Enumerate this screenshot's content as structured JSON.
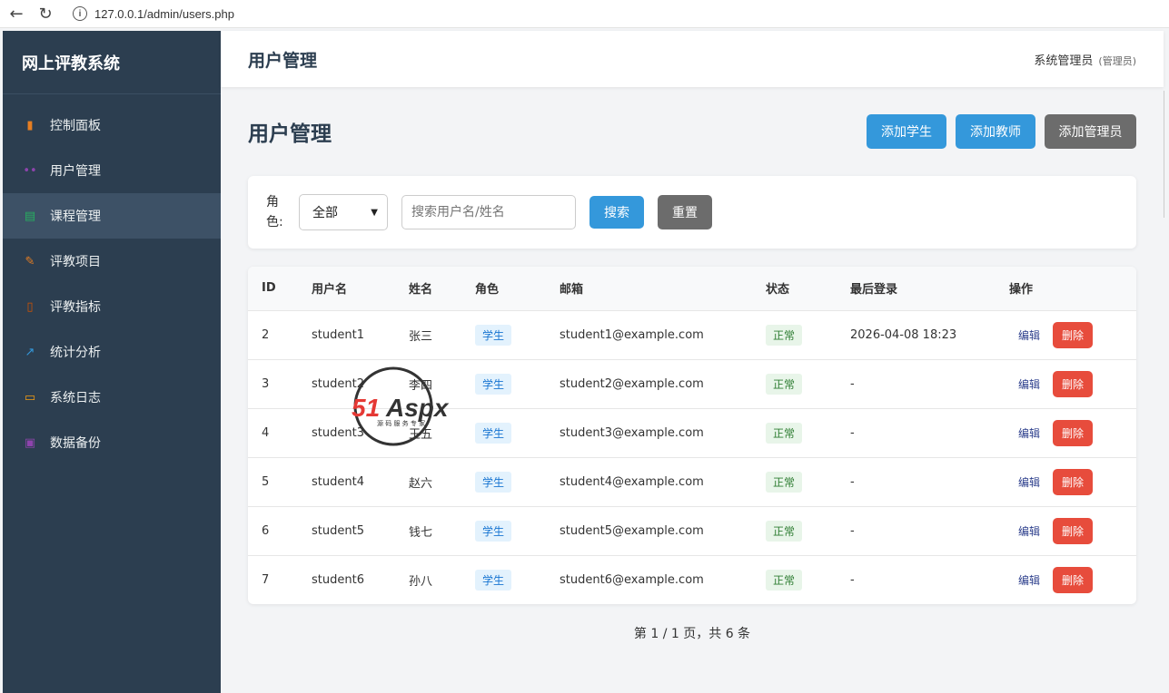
{
  "browser": {
    "url": "127.0.0.1/admin/users.php"
  },
  "sidebar": {
    "brand": "网上评教系统",
    "items": [
      {
        "label": "控制面板",
        "icon": "bar-chart-icon",
        "color": "#e67e22"
      },
      {
        "label": "用户管理",
        "icon": "users-icon",
        "color": "#8e44ad"
      },
      {
        "label": "课程管理",
        "icon": "books-icon",
        "color": "#27ae60"
      },
      {
        "label": "评教项目",
        "icon": "memo-icon",
        "color": "#e67e22"
      },
      {
        "label": "评教指标",
        "icon": "clipboard-icon",
        "color": "#d35400"
      },
      {
        "label": "统计分析",
        "icon": "line-chart-icon",
        "color": "#3498db"
      },
      {
        "label": "系统日志",
        "icon": "scroll-icon",
        "color": "#f39c12"
      },
      {
        "label": "数据备份",
        "icon": "floppy-disk-icon",
        "color": "#8e44ad"
      }
    ],
    "active_index": 2
  },
  "topbar": {
    "title": "用户管理",
    "user": "系统管理员",
    "role": "(管理员)"
  },
  "page": {
    "title": "用户管理",
    "add_student": "添加学生",
    "add_teacher": "添加教师",
    "add_admin": "添加管理员"
  },
  "filter": {
    "role_label": "角色:",
    "role_selected": "全部",
    "search_placeholder": "搜索用户名/姓名",
    "search_btn": "搜索",
    "reset_btn": "重置"
  },
  "table": {
    "headers": [
      "ID",
      "用户名",
      "姓名",
      "角色",
      "邮箱",
      "状态",
      "最后登录",
      "操作"
    ],
    "rows": [
      {
        "id": "2",
        "username": "student1",
        "name": "张三",
        "role": "学生",
        "email": "student1@example.com",
        "status": "正常",
        "last_login": "2026-04-08 18:23",
        "edit": "编辑",
        "delete": "删除"
      },
      {
        "id": "3",
        "username": "student2",
        "name": "李四",
        "role": "学生",
        "email": "student2@example.com",
        "status": "正常",
        "last_login": "-",
        "edit": "编辑",
        "delete": "删除"
      },
      {
        "id": "4",
        "username": "student3",
        "name": "王五",
        "role": "学生",
        "email": "student3@example.com",
        "status": "正常",
        "last_login": "-",
        "edit": "编辑",
        "delete": "删除"
      },
      {
        "id": "5",
        "username": "student4",
        "name": "赵六",
        "role": "学生",
        "email": "student4@example.com",
        "status": "正常",
        "last_login": "-",
        "edit": "编辑",
        "delete": "删除"
      },
      {
        "id": "6",
        "username": "student5",
        "name": "钱七",
        "role": "学生",
        "email": "student5@example.com",
        "status": "正常",
        "last_login": "-",
        "edit": "编辑",
        "delete": "删除"
      },
      {
        "id": "7",
        "username": "student6",
        "name": "孙八",
        "role": "学生",
        "email": "student6@example.com",
        "status": "正常",
        "last_login": "-",
        "edit": "编辑",
        "delete": "删除"
      }
    ]
  },
  "pagination": {
    "text": "第 1 / 1 页，共 6 条"
  },
  "watermark": {
    "brand": "51Aspx",
    "tagline": "源码服务专家"
  }
}
